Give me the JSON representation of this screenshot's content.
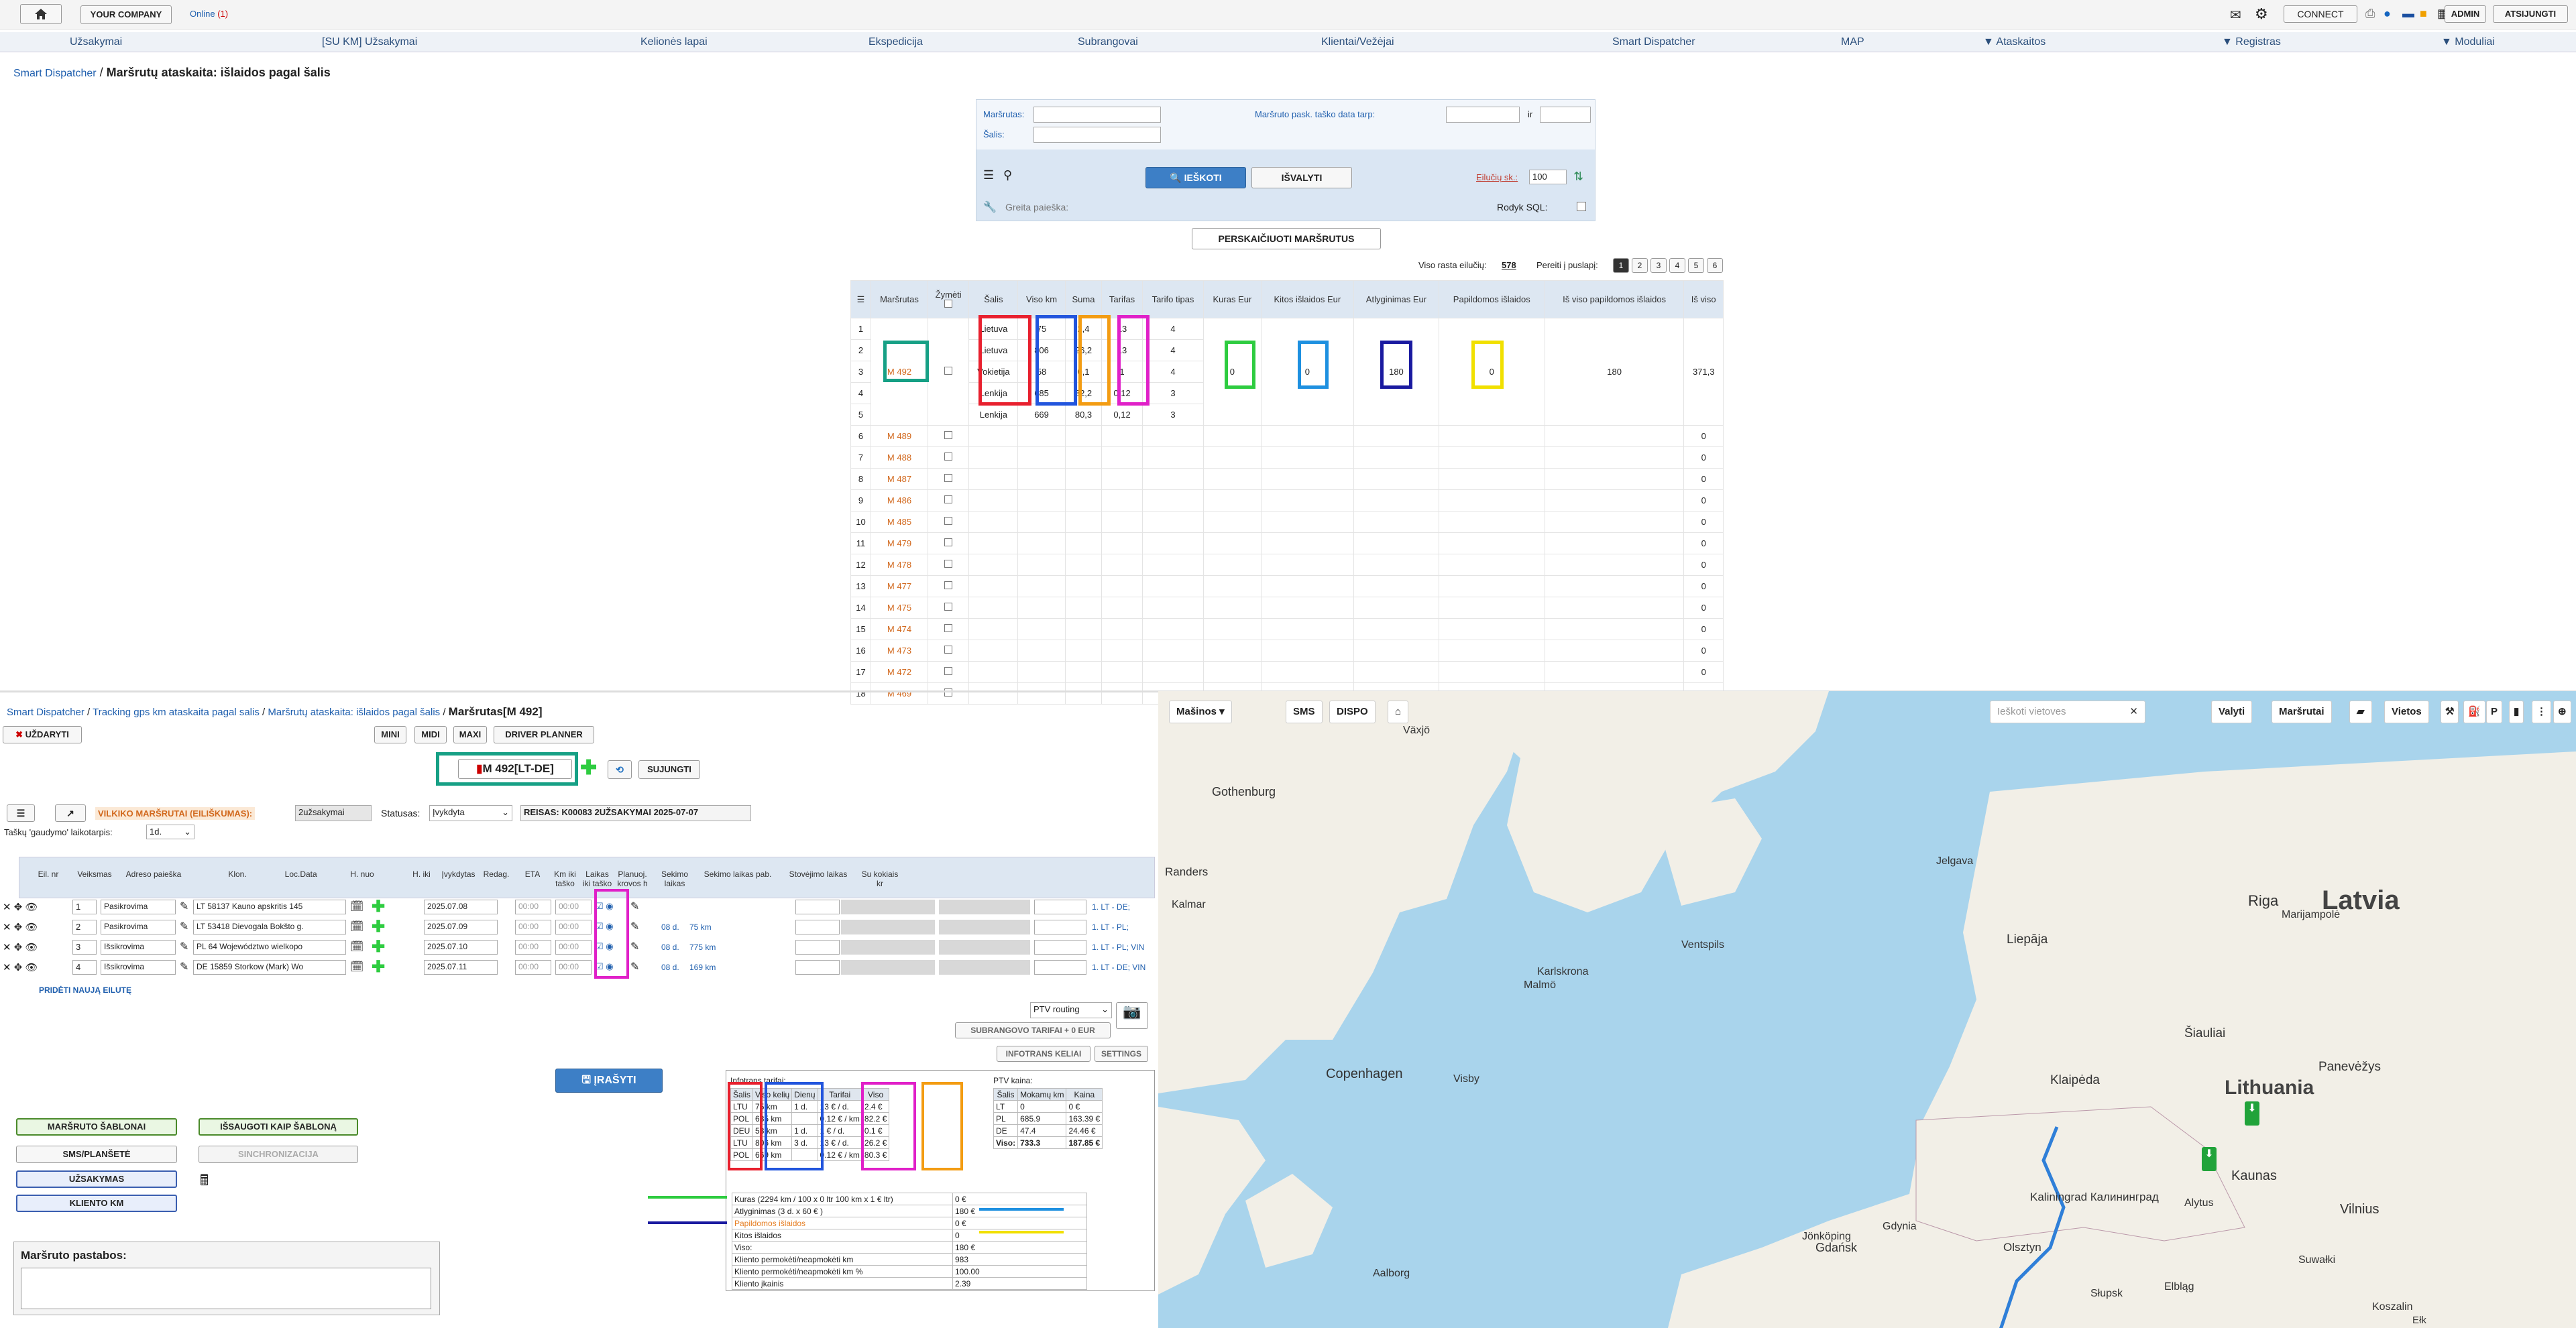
{
  "topbar": {
    "company": "YOUR COMPANY",
    "online_label": "Online",
    "online_count": "(1)",
    "connect": "CONNECT",
    "admin": "ADMIN",
    "logout": "ATSIJUNGTI"
  },
  "nav": [
    "Užsakymai",
    "[SU KM] Užsakymai",
    "Kelionės lapai",
    "Ekspedicija",
    "Subrangovai",
    "Klientai/Vežėjai",
    "Smart Dispatcher",
    "MAP",
    "▼ Ataskaitos",
    "▼ Registras",
    "▼ Moduliai"
  ],
  "breadcrumb1": {
    "home": "Smart Dispatcher",
    "current": "Maršrutų ataskaita: išlaidos pagal šalis"
  },
  "filter": {
    "route_label": "Maršrutas:",
    "country_label": "Šalis:",
    "date_label": "Maršruto pask. taško data tarp:",
    "and_label": "ir",
    "search_button": "IEŠKOTI",
    "clear_button": "IŠVALYTI",
    "rows_label": "Eilučių sk.:",
    "rows_value": "100",
    "quick_search": "Greita paieška:",
    "show_sql": "Rodyk SQL:"
  },
  "recalc_button": "PERSKAIČIUOTI MARŠRUTUS",
  "pager": {
    "total_label": "Viso rasta eilučių:",
    "total": "578",
    "goto_label": "Pereiti į puslapį:",
    "pages": [
      "1",
      "2",
      "3",
      "4",
      "5",
      "6"
    ]
  },
  "report": {
    "headers": [
      "",
      "Maršrutas",
      "Žymėti",
      "Šalis",
      "Viso km",
      "Suma",
      "Tarifas",
      "Tarifo tipas",
      "Kuras Eur",
      "Kitos išlaidos Eur",
      "Atlyginimas Eur",
      "Papildomos išlaidos",
      "Iš viso papildomos išlaidos",
      "Iš viso"
    ],
    "first": {
      "route": "M 492",
      "countries": [
        "Lietuva",
        "Lietuva",
        "Vokietija",
        "Lenkija",
        "Lenkija"
      ],
      "km": [
        "75",
        "806",
        "58",
        "685",
        "669"
      ],
      "sum": [
        "2,4",
        "26,2",
        "0,1",
        "82,2",
        "80,3"
      ],
      "rate": [
        "13",
        "13",
        "1",
        "0,12",
        "0,12"
      ],
      "rate_type": [
        "4",
        "4",
        "4",
        "3",
        "3"
      ],
      "fuel": "0",
      "other": "0",
      "salary": "180",
      "additional": "0",
      "total_additional": "180",
      "total": "371,3"
    },
    "rows": [
      [
        "6",
        "M 489",
        "0"
      ],
      [
        "7",
        "M 488",
        "0"
      ],
      [
        "8",
        "M 487",
        "0"
      ],
      [
        "9",
        "M 486",
        "0"
      ],
      [
        "10",
        "M 485",
        "0"
      ],
      [
        "11",
        "M 479",
        "0"
      ],
      [
        "12",
        "M 478",
        "0"
      ],
      [
        "13",
        "M 477",
        "0"
      ],
      [
        "14",
        "M 475",
        "0"
      ],
      [
        "15",
        "M 474",
        "0"
      ],
      [
        "16",
        "M 473",
        "0"
      ],
      [
        "17",
        "M 472",
        "0"
      ],
      [
        "18",
        "M 469",
        "0"
      ]
    ]
  },
  "breadcrumb2": {
    "a": "Smart Dispatcher",
    "b": "Tracking gps km ataskaita pagal salis",
    "c": "Maršrutų ataskaita: išlaidos pagal šalis",
    "current": "Maršrutas[M 492]"
  },
  "route": {
    "close": "UŽDARYTI",
    "mini": "MINI",
    "midi": "MIDI",
    "maxi": "MAXI",
    "planner": "DRIVER PLANNER",
    "title": "M 492[LT-DE]",
    "join": "SUJUNGTI",
    "truck_label": "VILKIKO MARŠRUTAI (EILIŠKUMAS):",
    "truck_value": "2užsakymai",
    "status_label": "Statusas:",
    "status_value": "Įvykdyta",
    "trip": "REISAS: K00083 2UŽSAKYMAI 2025-07-07",
    "gps_label": "Taškų 'gaudymo' laikotarpis:",
    "gps_value": "1d."
  },
  "stops": {
    "headers": [
      "Eil. nr",
      "Veiksmas",
      "Adreso paieška",
      "Klon.",
      "Loc.",
      "Data",
      "H. nuo",
      "H. iki",
      "Įvykdytas",
      "Redag.",
      "ETA",
      "Km iki taško",
      "Laikas iki taško",
      "Planuoj. krovos h",
      "Sekimo laikas",
      "Sekimo laikas pab.",
      "Stovėjimo laikas",
      "Su kokiais kr"
    ],
    "rows": [
      {
        "n": "1",
        "action": "Pasikrovima",
        "addr": "LT 58137 Kauno apskritis 145",
        "date": "2025.07.08",
        "h1": "00:00",
        "h2": "00:00",
        "eta": "",
        "km": "",
        "route": "1. LT - DE;"
      },
      {
        "n": "2",
        "action": "Pasikrovima",
        "addr": "LT 53418 Dievogala Bokšto g.",
        "date": "2025.07.09",
        "h1": "00:00",
        "h2": "00:00",
        "eta": "08 d.",
        "km": "75 km",
        "route": "1. LT - PL;"
      },
      {
        "n": "3",
        "action": "Išsikrovima",
        "addr": "PL 64 Województwo wielkopo",
        "date": "2025.07.10",
        "h1": "00:00",
        "h2": "00:00",
        "eta": "08 d.",
        "km": "775 km",
        "route": "1. LT - PL; VIN"
      },
      {
        "n": "4",
        "action": "Išsikrovima",
        "addr": "DE 15859 Storkow (Mark) Wo",
        "date": "2025.07.11",
        "h1": "00:00",
        "h2": "00:00",
        "eta": "08 d.",
        "km": "169 km",
        "route": "1. LT - DE; VIN"
      }
    ],
    "add_row": "PRIDĖTI NAUJĄ EILUTĘ"
  },
  "routing": {
    "select": "PTV routing",
    "sub": "SUBRANGOVO TARIFAI + 0 EUR",
    "infotrans": "INFOTRANS KELIAI",
    "settings": "SETTINGS"
  },
  "save_button": "ĮRAŠYTI",
  "left_buttons": {
    "templates": "MARŠRUTO ŠABLONAI",
    "save_template": "IŠSAUGOTI KAIP ŠABLONĄ",
    "sms": "SMS/PLANŠETĖ",
    "sync": "SINCHRONIZACIJA",
    "orders": "UŽSAKYMAS",
    "client_km": "KLIENTO KM"
  },
  "notes_label": "Maršruto pastabos:",
  "infotrans": {
    "title": "Infotrans tarifai:",
    "headers": [
      "Šalis",
      "Viso kelių",
      "Dienų",
      "Tarifai",
      "Viso"
    ],
    "rows": [
      [
        "LTU",
        "75 km",
        "1 d.",
        "13 € / d.",
        "2.4 €"
      ],
      [
        "POL",
        "685 km",
        "",
        "0.12 € / km",
        "82.2 €"
      ],
      [
        "DEU",
        "58 km",
        "1 d.",
        "1 € / d.",
        "0.1 €"
      ],
      [
        "LTU",
        "806 km",
        "3 d.",
        "13 € / d.",
        "26.2 €"
      ],
      [
        "POL",
        "669 km",
        "",
        "0.12 € / km",
        "80.3 €"
      ]
    ]
  },
  "ptv": {
    "title": "PTV kaina:",
    "headers": [
      "Šalis",
      "Mokamų km",
      "Kaina"
    ],
    "rows": [
      [
        "LT",
        "0",
        "0 €"
      ],
      [
        "PL",
        "685.9",
        "163.39 €"
      ],
      [
        "DE",
        "47.4",
        "24.46 €"
      ]
    ],
    "total_label": "Viso:",
    "total_km": "733.3",
    "total": "187.85 €"
  },
  "summary": [
    [
      "Kuras (2294 km / 100 x 0 ltr 100 km x 1 € ltr)",
      "0 €"
    ],
    [
      "Atlyginimas (3 d. x 60 € )",
      "180 €"
    ],
    [
      "Papildomos išlaidos",
      "0 €"
    ],
    [
      "Kitos išlaidos",
      "0"
    ],
    [
      "Viso:",
      "180 €"
    ],
    [
      "Kliento permokėti/neapmokėti km",
      "983"
    ],
    [
      "Kliento permokėti/neapmokėti km %",
      "100.00"
    ],
    [
      "Kliento įkainis",
      "2.39"
    ]
  ],
  "map": {
    "toolbar": {
      "trucks": "Mašinos",
      "sms": "SMS",
      "dispo": "DISPO",
      "search": "Ieškoti vietoves",
      "valyti": "Valyti",
      "routes": "Maršrutai",
      "places": "Vietos"
    },
    "labels": [
      "Latvia",
      "Lithuania",
      "Riga",
      "Kaunas",
      "Vilnius",
      "Copenhagen",
      "Gdańsk",
      "Gothenburg",
      "Klaipėda",
      "Šiauliai",
      "Panevėžys",
      "Liepāja",
      "Kaliningrad Калининград",
      "Olsztyn",
      "Koszalin",
      "Słupsk",
      "Gdynia",
      "Jönköping",
      "Växjö",
      "Malmö",
      "Aalborg",
      "Randers",
      "Kalmar",
      "Karlskrona",
      "Visby",
      "Ventspils",
      "Jelgava",
      "Marijampolė",
      "Alytus",
      "Suwałki",
      "Elbląg",
      "Ełk"
    ],
    "route_color": "#2f7fd8",
    "land": "#f2efe7"
  },
  "colors": {
    "red": "#e8202e",
    "blue": "#2255dd",
    "orange": "#f39c12",
    "magenta": "#e020c8",
    "teal": "#16a085",
    "green": "#2ecc40",
    "azure": "#1e90e0",
    "navy": "#1a1aa0",
    "yellow": "#f1e000"
  }
}
